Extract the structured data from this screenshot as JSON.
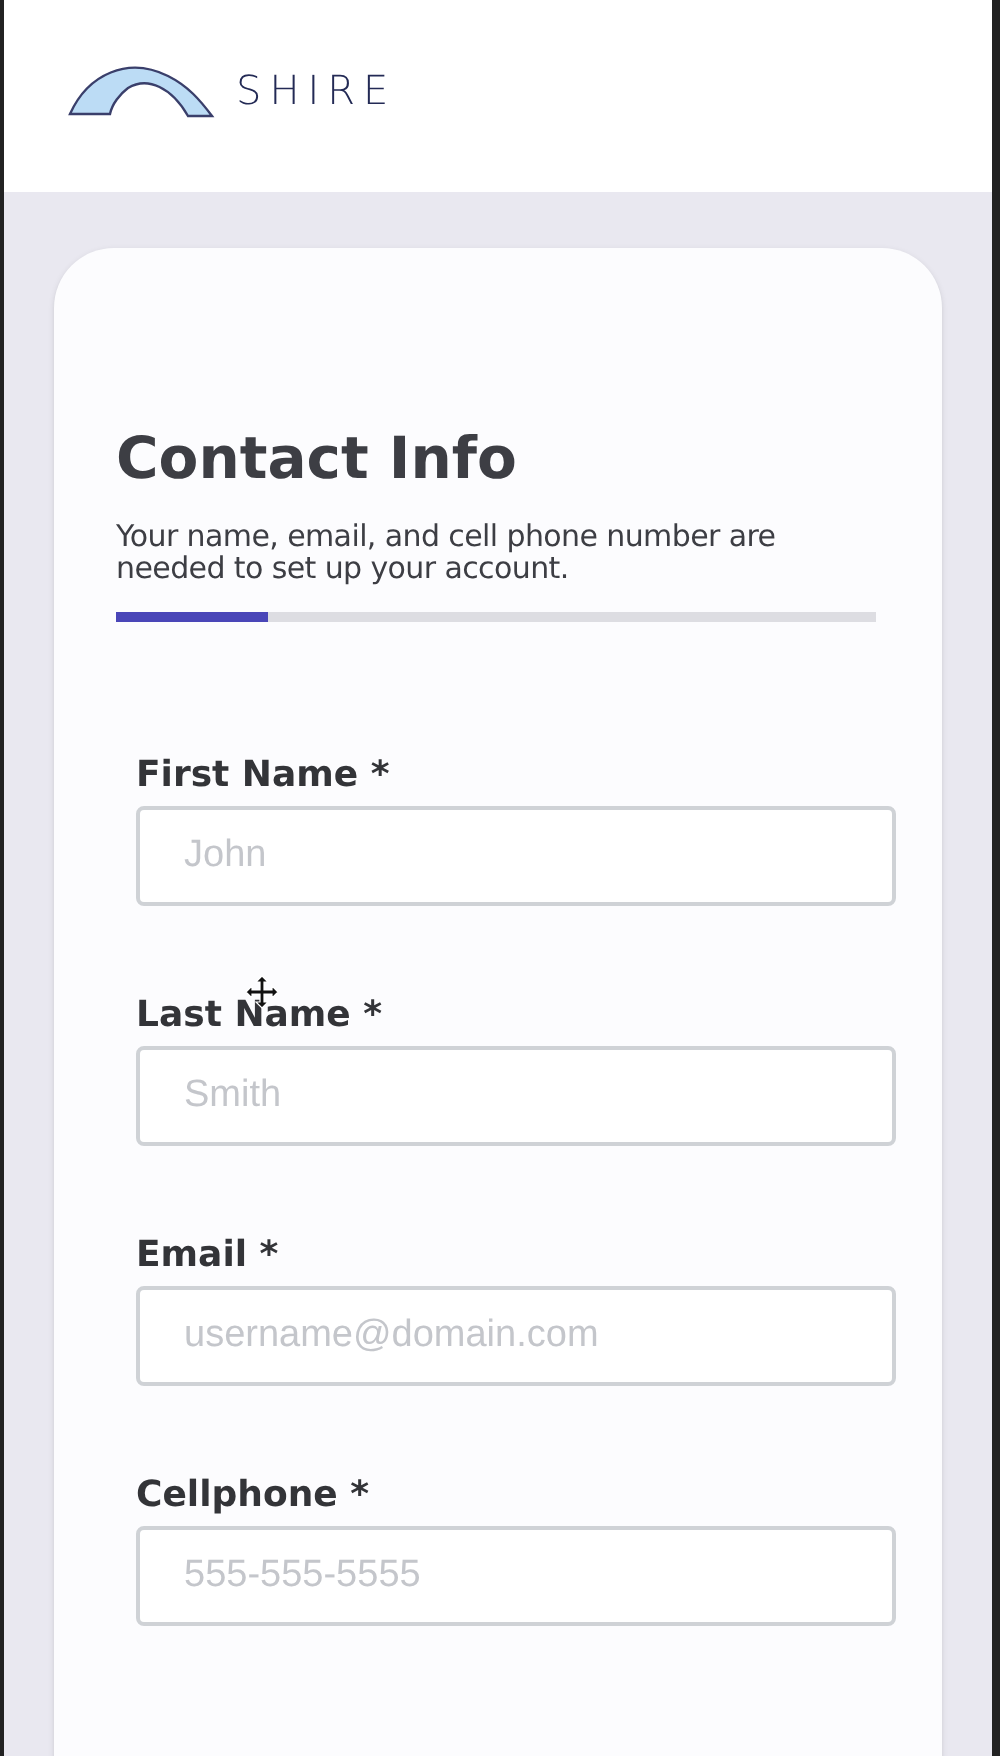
{
  "header": {
    "brand": "SHIRE"
  },
  "card": {
    "title": "Contact Info",
    "description": "Your name, email, and cell phone number are needed to set up your account.",
    "progress": {
      "level": 0.2
    }
  },
  "fields": [
    {
      "label": "First Name *",
      "placeholder": "John"
    },
    {
      "label": "Last Name *",
      "placeholder": "Smith"
    },
    {
      "label": "Email *",
      "placeholder": "username@domain.com"
    },
    {
      "label": "Cellphone *",
      "placeholder": "555-555-5555"
    }
  ]
}
